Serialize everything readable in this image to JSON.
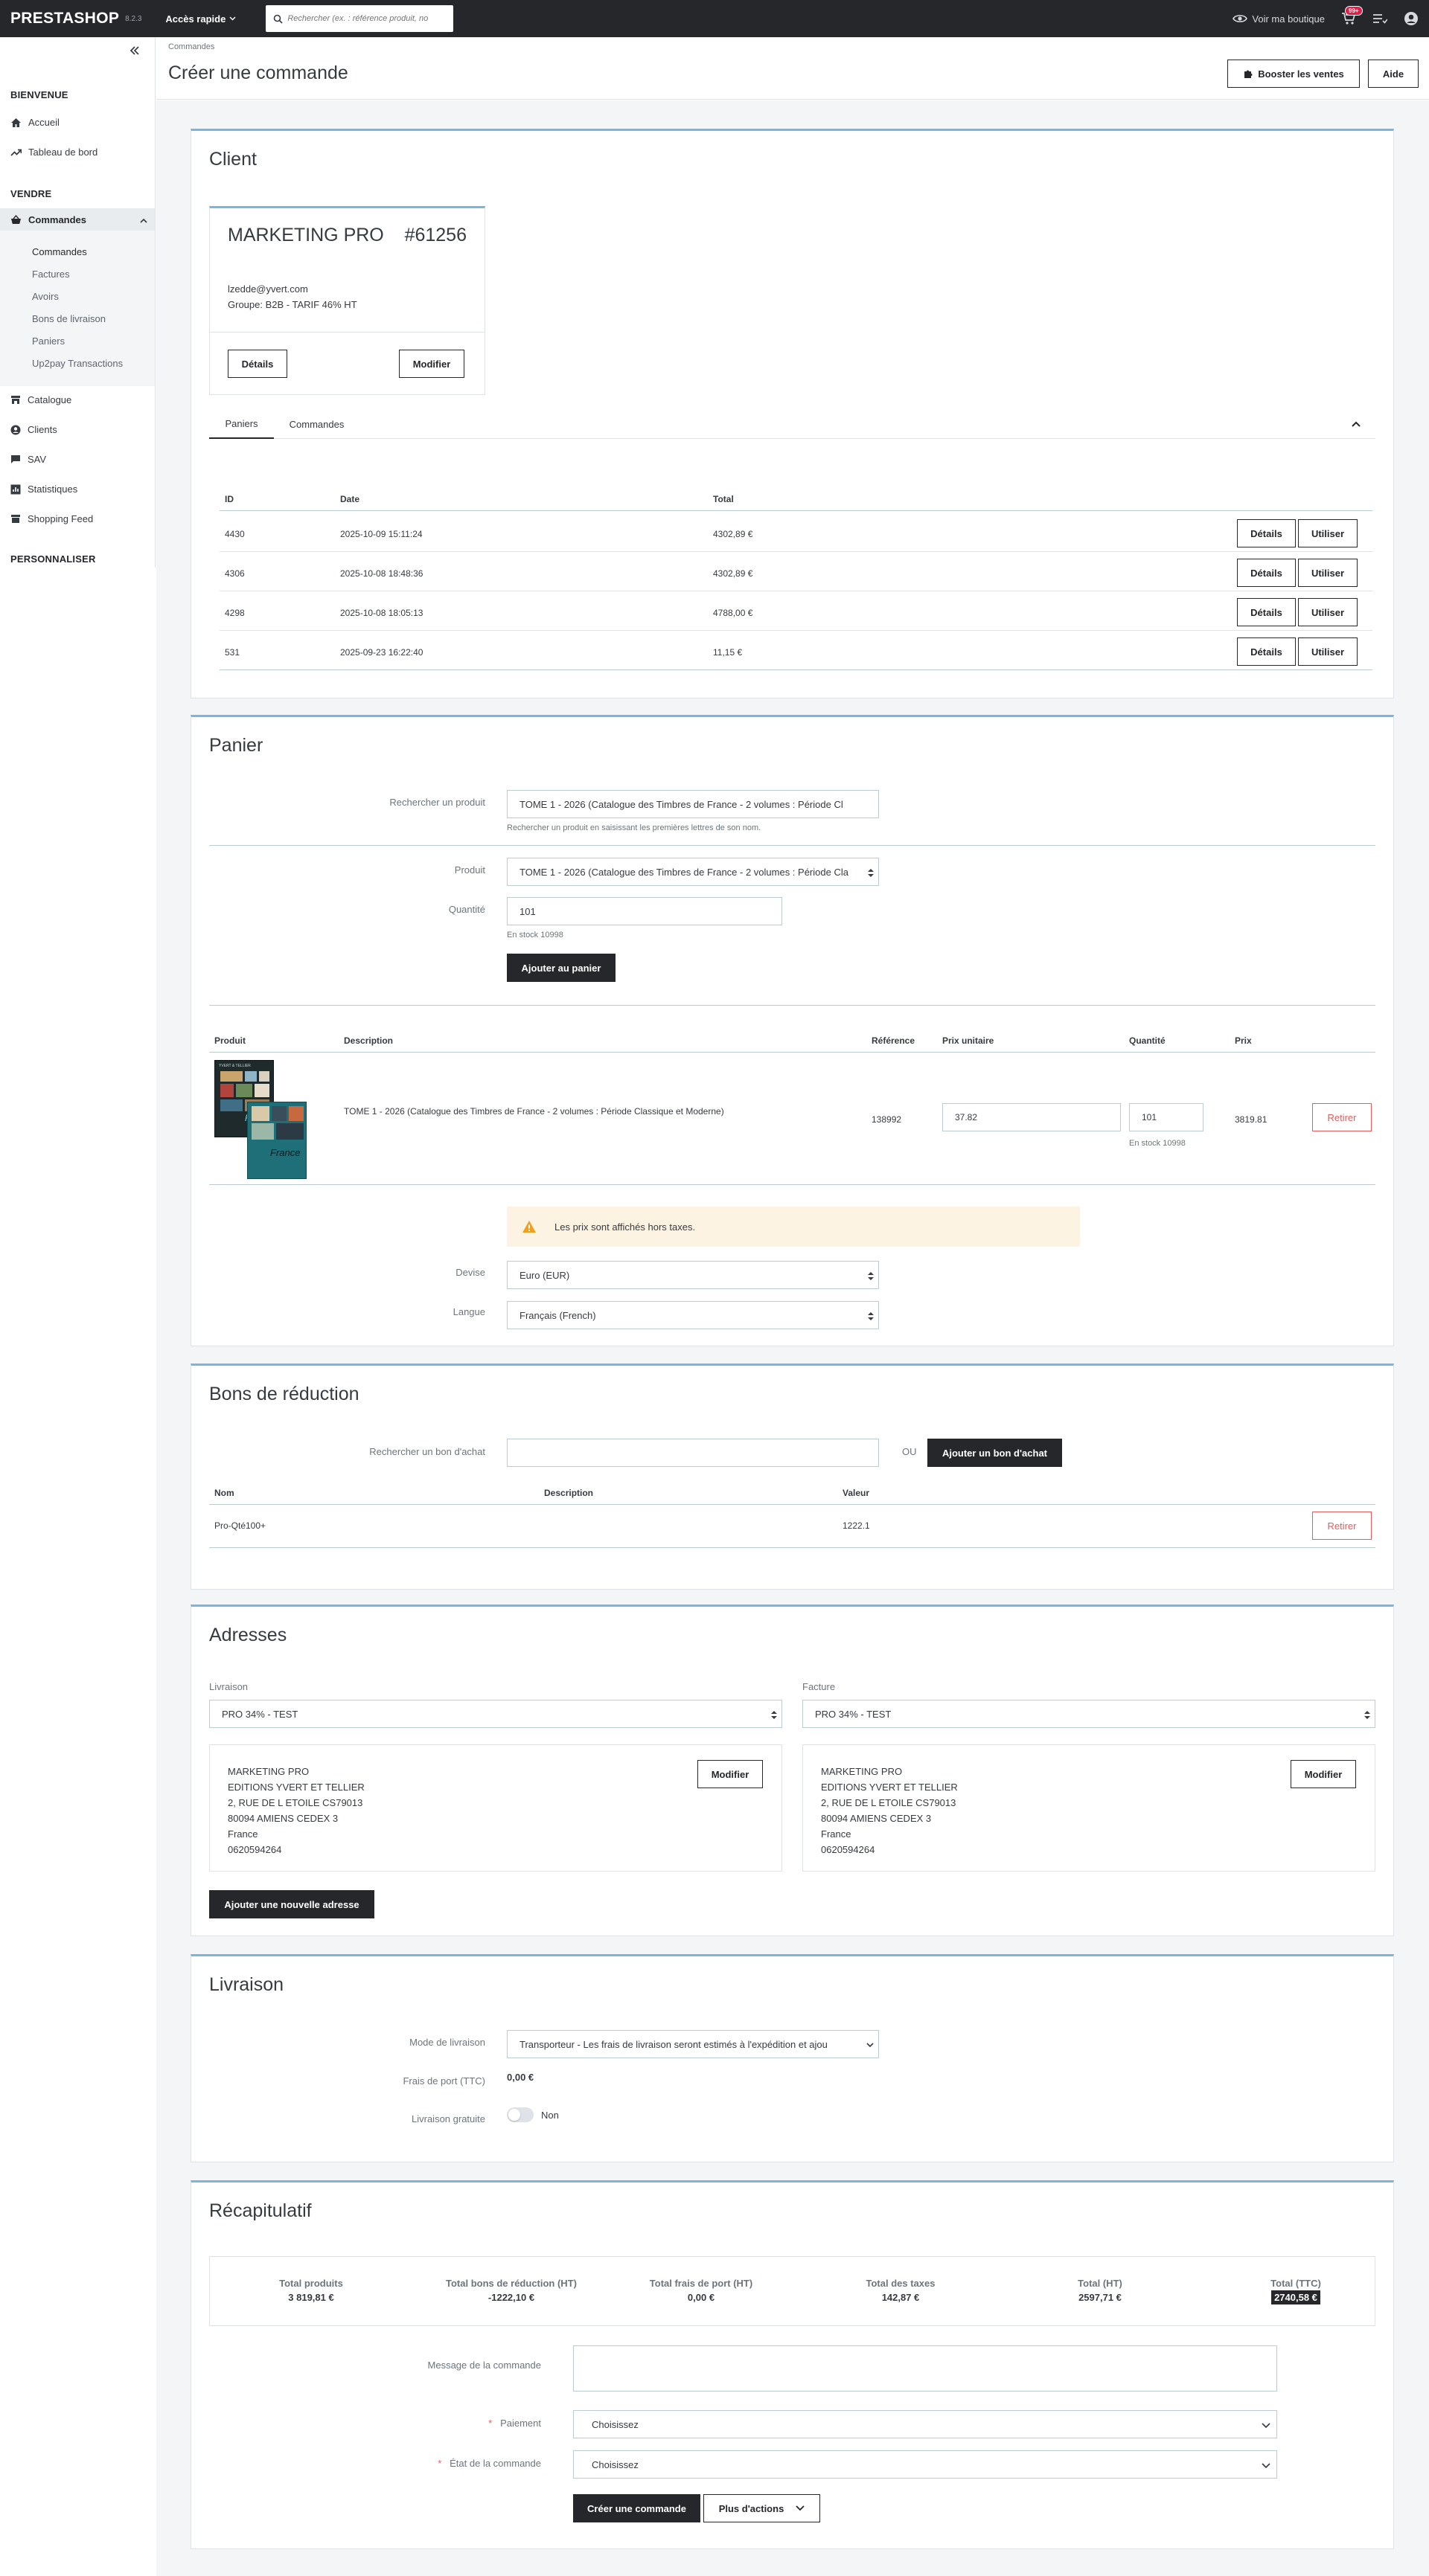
{
  "topbar": {
    "logo": "PRESTASHOP",
    "version": "8.2.3",
    "quick_access": "Accès rapide",
    "search_placeholder": "Rechercher (ex. : référence produit, no",
    "view_shop": "Voir ma boutique",
    "notif_count": "99+"
  },
  "sidebar": {
    "welcome": "BIENVENUE",
    "home": "Accueil",
    "dashboard": "Tableau de bord",
    "sell": "VENDRE",
    "orders": "Commandes",
    "orders_sub": [
      "Commandes",
      "Factures",
      "Avoirs",
      "Bons de livraison",
      "Paniers",
      "Up2pay Transactions"
    ],
    "catalog": "Catalogue",
    "customers": "Clients",
    "sav": "SAV",
    "stats": "Statistiques",
    "shopping_feed": "Shopping Feed",
    "customize": "PERSONNALISER"
  },
  "header": {
    "breadcrumb": "Commandes",
    "title": "Créer une commande",
    "boost": "Booster les ventes",
    "help": "Aide"
  },
  "client": {
    "title": "Client",
    "name": "MARKETING PRO",
    "id": "#61256",
    "email": "lzedde@yvert.com",
    "group": "Groupe: B2B - TARIF 46% HT",
    "details": "Détails",
    "edit": "Modifier",
    "tabs": [
      "Paniers",
      "Commandes"
    ],
    "cart_headers": [
      "ID",
      "Date",
      "Total"
    ],
    "carts": [
      {
        "id": "4430",
        "date": "2025-10-09 15:11:24",
        "total": "4302,89 €"
      },
      {
        "id": "4306",
        "date": "2025-10-08 18:48:36",
        "total": "4302,89 €"
      },
      {
        "id": "4298",
        "date": "2025-10-08 18:05:13",
        "total": "4788,00 €"
      },
      {
        "id": "531",
        "date": "2025-09-23 16:22:40",
        "total": "11,15 €"
      }
    ],
    "row_details": "Détails",
    "row_use": "Utiliser"
  },
  "cart": {
    "title": "Panier",
    "search_label": "Rechercher un produit",
    "search_value": "TOME 1 - 2026 (Catalogue des Timbres de France - 2 volumes : Période Cl",
    "search_help": "Rechercher un produit en saisissant les premières lettres de son nom.",
    "product_label": "Produit",
    "product_value": "TOME 1 - 2026 (Catalogue des Timbres de France - 2 volumes : Période Cla",
    "qty_label": "Quantité",
    "qty_value": "101",
    "stock": "En stock 10998",
    "add": "Ajouter au panier",
    "headers": [
      "Produit",
      "Description",
      "Référence",
      "Prix unitaire",
      "Quantité",
      "Prix"
    ],
    "item": {
      "description": "TOME 1 - 2026 (Catalogue des Timbres de France - 2 volumes : Période Classique et Moderne)",
      "reference": "138992",
      "unit_price": "37.82",
      "quantity": "101",
      "stock": "En stock 10998",
      "price": "3819.81",
      "remove": "Retirer",
      "cover_top_text": "YVERT & TELLIER",
      "cover_word": "France"
    },
    "warning": "Les prix sont affichés hors taxes.",
    "currency_label": "Devise",
    "currency_value": "Euro (EUR)",
    "lang_label": "Langue",
    "lang_value": "Français (French)"
  },
  "vouchers": {
    "title": "Bons de réduction",
    "search_label": "Rechercher un bon d'achat",
    "or": "OU",
    "add": "Ajouter un bon d'achat",
    "headers": [
      "Nom",
      "Description",
      "Valeur"
    ],
    "rows": [
      {
        "name": "Pro-Qté100+",
        "description": "",
        "value": "1222.1",
        "remove": "Retirer"
      }
    ]
  },
  "addresses": {
    "title": "Adresses",
    "delivery_label": "Livraison",
    "invoice_label": "Facture",
    "delivery_select": "PRO 34% - TEST",
    "invoice_select": "PRO 34% - TEST",
    "delivery_lines": [
      "MARKETING PRO",
      "EDITIONS YVERT ET TELLIER",
      "2, RUE DE L ETOILE CS79013",
      "80094 AMIENS CEDEX 3",
      "France",
      "0620594264"
    ],
    "invoice_lines": [
      "MARKETING PRO",
      "EDITIONS YVERT ET TELLIER",
      "2, RUE DE L ETOILE CS79013",
      "80094 AMIENS CEDEX 3",
      "France",
      "0620594264"
    ],
    "edit": "Modifier",
    "add_new": "Ajouter une nouvelle adresse"
  },
  "shipping": {
    "title": "Livraison",
    "mode_label": "Mode de livraison",
    "mode_value": "Transporteur - Les frais de livraison seront estimés à l'expédition et ajou",
    "fee_label": "Frais de port (TTC)",
    "fee_value": "0,00 €",
    "free_label": "Livraison gratuite",
    "free_value": "Non"
  },
  "summary": {
    "title": "Récapitulatif",
    "cols": [
      {
        "label": "Total produits",
        "value": "3 819,81 €"
      },
      {
        "label": "Total bons de réduction (HT)",
        "value": "-1222,10 €"
      },
      {
        "label": "Total frais de port (HT)",
        "value": "0,00 €"
      },
      {
        "label": "Total des taxes",
        "value": "142,87 €"
      },
      {
        "label": "Total (HT)",
        "value": "2597,71 €"
      },
      {
        "label": "Total (TTC)",
        "value": "2740,58 €"
      }
    ],
    "message_label": "Message de la commande",
    "payment_label": "Paiement",
    "payment_value": "Choisissez",
    "state_label": "État de la commande",
    "state_value": "Choisissez",
    "required_mark": "*",
    "create": "Créer une commande",
    "more": "Plus d'actions"
  }
}
